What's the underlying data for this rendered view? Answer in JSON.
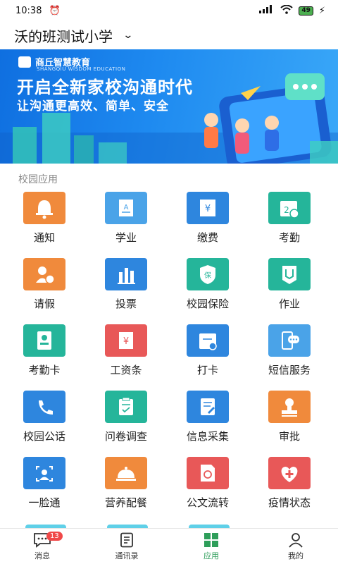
{
  "status": {
    "time": "10:38",
    "battery": "49"
  },
  "header": {
    "school": "沃的班测试小学"
  },
  "banner": {
    "logo": "商丘智慧教育",
    "logo_en": "SHANGQIU WISDOM EDUCATION",
    "headline": "开启全新家校沟通时代",
    "subline": "让沟通更高效、简单、安全"
  },
  "section": {
    "title": "校园应用"
  },
  "apps": [
    {
      "label": "通知",
      "icon": "bell-icon",
      "color": "#f08a3c"
    },
    {
      "label": "学业",
      "icon": "report-icon",
      "color": "#4aa3e8"
    },
    {
      "label": "缴费",
      "icon": "fee-icon",
      "color": "#2e86de"
    },
    {
      "label": "考勤",
      "icon": "calendar-icon",
      "color": "#25b59a"
    },
    {
      "label": "请假",
      "icon": "leave-icon",
      "color": "#f08a3c"
    },
    {
      "label": "投票",
      "icon": "bar-chart-icon",
      "color": "#2e86de"
    },
    {
      "label": "校园保险",
      "icon": "shield-icon",
      "color": "#25b59a"
    },
    {
      "label": "作业",
      "icon": "homework-icon",
      "color": "#25b59a"
    },
    {
      "label": "考勤卡",
      "icon": "id-card-icon",
      "color": "#25b59a"
    },
    {
      "label": "工资条",
      "icon": "salary-icon",
      "color": "#e85858"
    },
    {
      "label": "打卡",
      "icon": "clock-in-icon",
      "color": "#2e86de"
    },
    {
      "label": "短信服务",
      "icon": "sms-icon",
      "color": "#4aa3e8"
    },
    {
      "label": "校园公话",
      "icon": "phone-icon",
      "color": "#2e86de"
    },
    {
      "label": "问卷调查",
      "icon": "survey-icon",
      "color": "#25b59a"
    },
    {
      "label": "信息采集",
      "icon": "collect-icon",
      "color": "#2e86de"
    },
    {
      "label": "审批",
      "icon": "approval-icon",
      "color": "#f08a3c"
    },
    {
      "label": "一脸通",
      "icon": "face-icon",
      "color": "#2e86de"
    },
    {
      "label": "营养配餐",
      "icon": "meal-icon",
      "color": "#f08a3c"
    },
    {
      "label": "公文流转",
      "icon": "document-icon",
      "color": "#e85858"
    },
    {
      "label": "疫情状态",
      "icon": "health-icon",
      "color": "#e85858"
    }
  ],
  "tabs": [
    {
      "label": "消息",
      "icon": "message-icon",
      "badge": "13"
    },
    {
      "label": "通讯录",
      "icon": "contacts-icon"
    },
    {
      "label": "应用",
      "icon": "apps-icon",
      "active": true
    },
    {
      "label": "我的",
      "icon": "profile-icon"
    }
  ]
}
